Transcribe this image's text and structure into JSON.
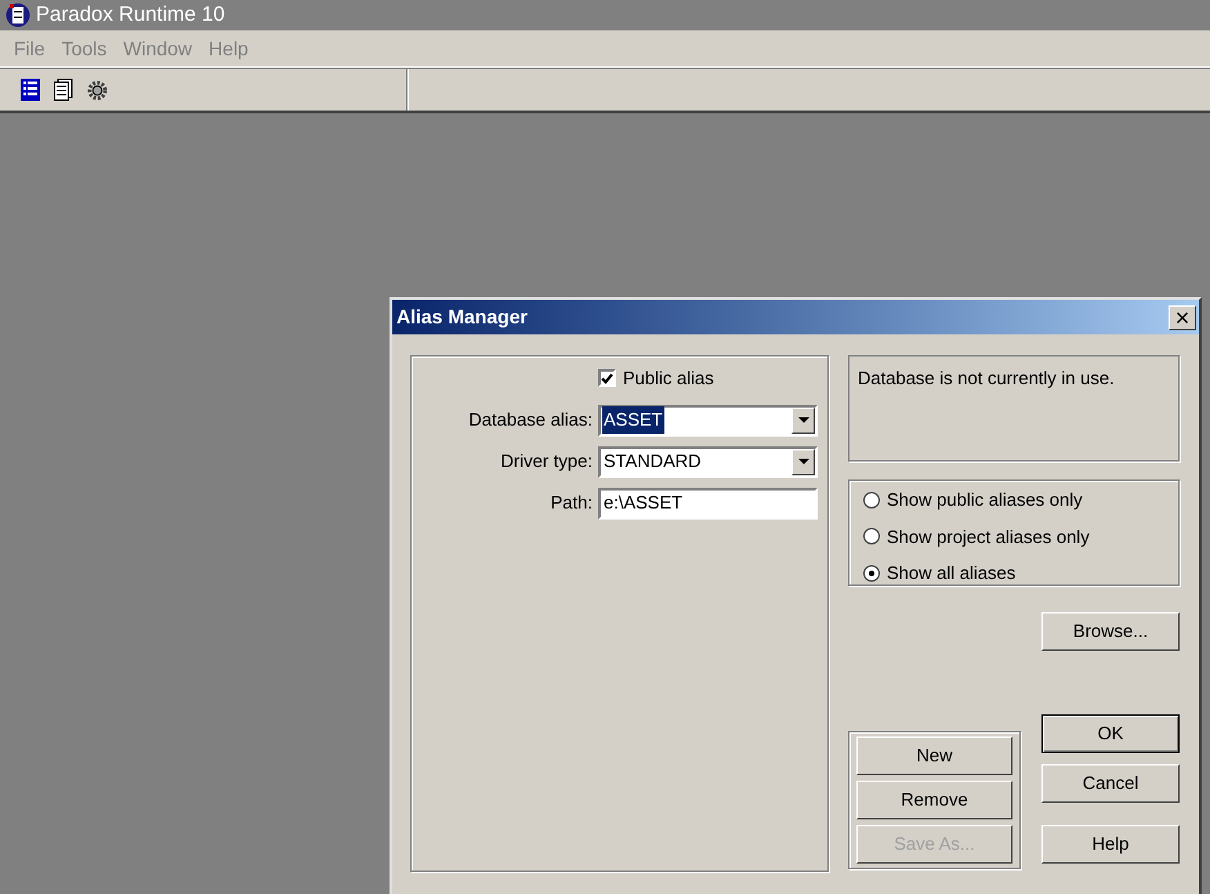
{
  "app": {
    "title": "Paradox Runtime 10"
  },
  "menu": [
    "File",
    "Tools",
    "Window",
    "Help"
  ],
  "toolbar": [
    {
      "kind": "list"
    },
    {
      "kind": "document"
    },
    {
      "kind": "gear"
    }
  ],
  "dialog": {
    "title": "Alias Manager",
    "close": "×",
    "public_alias": {
      "label": "Public alias",
      "checked": true
    },
    "fields": [
      {
        "kind": "combo",
        "label": "Database alias:",
        "value": "ASSET",
        "selected": true
      },
      {
        "kind": "combo",
        "label": "Driver type:",
        "value": "STANDARD",
        "selected": false
      },
      {
        "kind": "text",
        "label": "Path:",
        "value": "e:\\ASSET",
        "selected": false
      }
    ],
    "status": "Database is not currently in use.",
    "radios": [
      {
        "label": "Show public aliases only",
        "selected": false
      },
      {
        "label": "Show project aliases only",
        "selected": false
      },
      {
        "label": "Show all aliases",
        "selected": true
      }
    ],
    "browse": "Browse...",
    "alias_buttons": [
      {
        "label": "New",
        "disabled": false
      },
      {
        "label": "Remove",
        "disabled": false
      },
      {
        "label": "Save As...",
        "disabled": true
      }
    ],
    "ok": "OK",
    "cancel": "Cancel",
    "help": "Help"
  }
}
